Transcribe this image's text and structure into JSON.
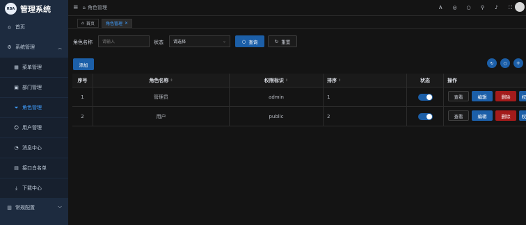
{
  "sidebar": {
    "logo_badge": "RBA",
    "title": "管理系统",
    "items": [
      {
        "label": "首页",
        "icon": "home-icon",
        "glyph": "⌂"
      },
      {
        "label": "系统管理",
        "icon": "gear-icon",
        "glyph": "⚙"
      },
      {
        "label": "菜单管理",
        "icon": "grid-icon",
        "glyph": "▦"
      },
      {
        "label": "部门管理",
        "icon": "building-icon",
        "glyph": "▣"
      },
      {
        "label": "角色管理",
        "icon": "filter-icon",
        "glyph": "⏷"
      },
      {
        "label": "用户管理",
        "icon": "user-icon",
        "glyph": "☺"
      },
      {
        "label": "消息中心",
        "icon": "message-icon",
        "glyph": "◔"
      },
      {
        "label": "接口白名单",
        "icon": "list-icon",
        "glyph": "▤"
      },
      {
        "label": "下载中心",
        "icon": "download-icon",
        "glyph": "⤓"
      },
      {
        "label": "常规配置",
        "icon": "settings-icon",
        "glyph": "▥"
      }
    ]
  },
  "header": {
    "breadcrumb": "角色管理",
    "icons": [
      "translate-icon",
      "github-icon",
      "search-icon",
      "theme-icon",
      "bell-icon",
      "fullscreen-icon"
    ],
    "icon_glyphs": [
      "Ꭺ",
      "◎",
      "○",
      "⚲",
      "♪",
      "⛶"
    ]
  },
  "tags": {
    "home": "首页",
    "current": "角色管理",
    "close": "✕"
  },
  "search": {
    "role_name_label": "角色名称",
    "role_name_placeholder": "请输入",
    "status_label": "状态",
    "status_value": "请选择",
    "query_label": "查询",
    "reset_label": "重置",
    "add_label": "添加"
  },
  "table": {
    "headers": [
      "序号",
      "角色名称",
      "权限标识",
      "排序",
      "状态",
      "操作"
    ],
    "rows": [
      {
        "index": "1",
        "name": "管理员",
        "key": "admin",
        "sort": "1",
        "enabled": true
      },
      {
        "index": "2",
        "name": "用户",
        "key": "public",
        "sort": "2",
        "enabled": true
      }
    ],
    "ops": {
      "view": "查看",
      "edit": "编辑",
      "delete": "删除",
      "more": "权"
    }
  },
  "colors": {
    "primary": "#1c5fa8",
    "danger": "#a31b1b",
    "sidebar": "#1d2b3f",
    "active_text": "#409eff"
  }
}
